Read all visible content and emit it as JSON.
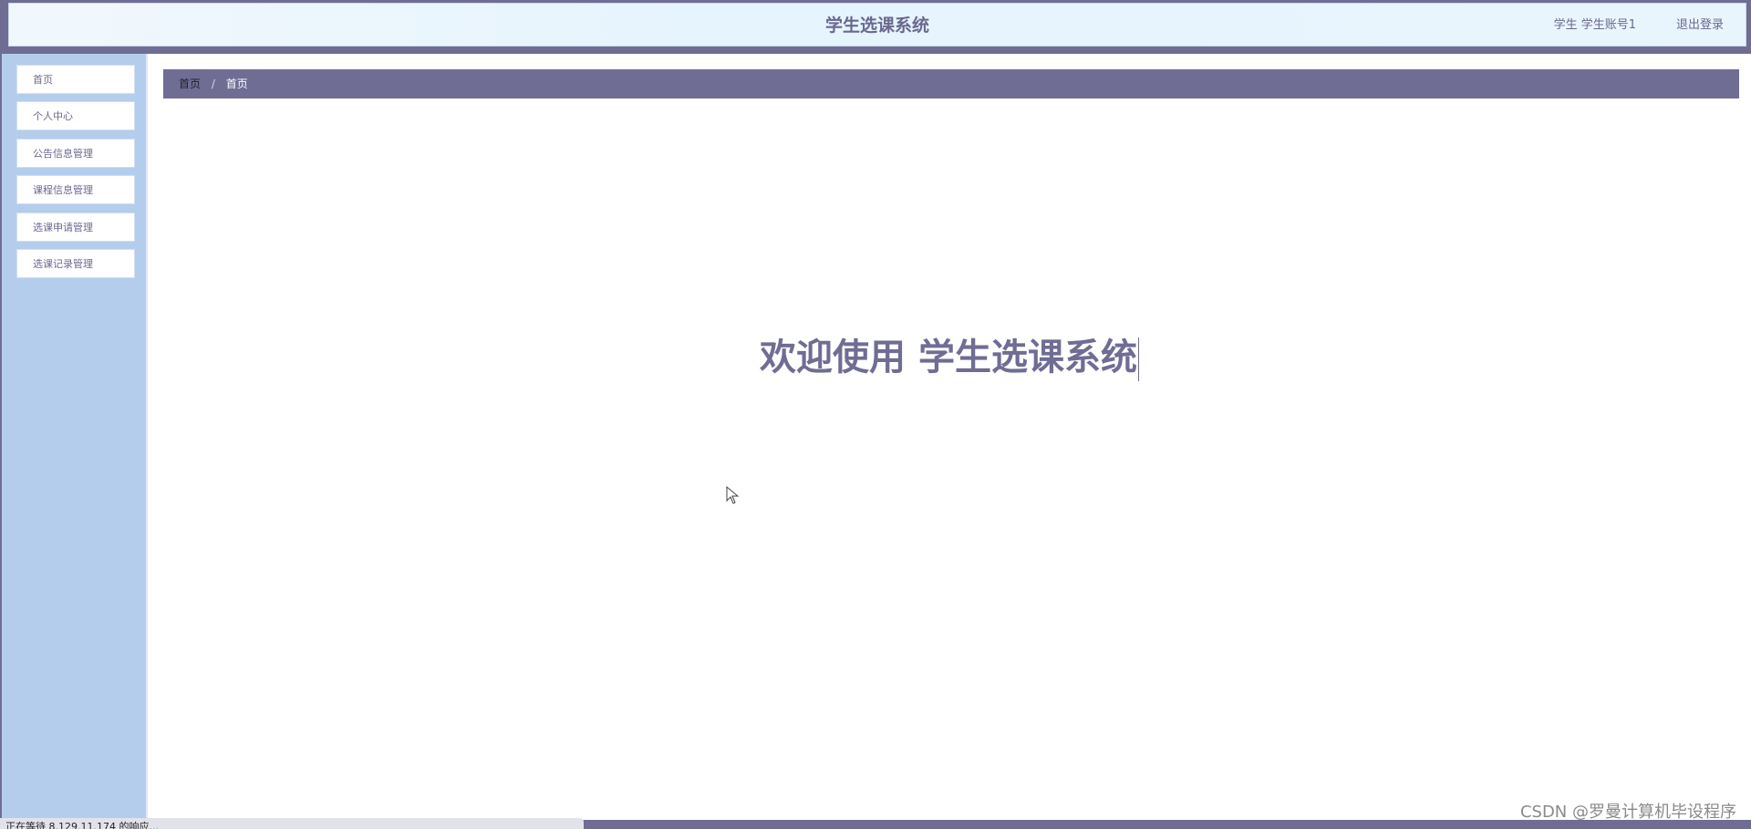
{
  "header": {
    "title": "学生选课系统",
    "user": "学生 学生账号1",
    "logout": "退出登录"
  },
  "sidebar": {
    "items": [
      {
        "label": "首页"
      },
      {
        "label": "个人中心"
      },
      {
        "label": "公告信息管理"
      },
      {
        "label": "课程信息管理"
      },
      {
        "label": "选课申请管理"
      },
      {
        "label": "选课记录管理"
      }
    ]
  },
  "breadcrumb": {
    "root": "首页",
    "separator": "/",
    "current": "首页"
  },
  "main": {
    "welcome": "欢迎使用 学生选课系统"
  },
  "status": {
    "text": "正在等待 8.129.11.174 的响应..."
  },
  "watermark": "CSDN @罗曼计算机毕设程序",
  "colors": {
    "accent": "#6f6d94",
    "sidebar_bg": "#b4cdec",
    "header_bg": "#e9f5fd"
  }
}
